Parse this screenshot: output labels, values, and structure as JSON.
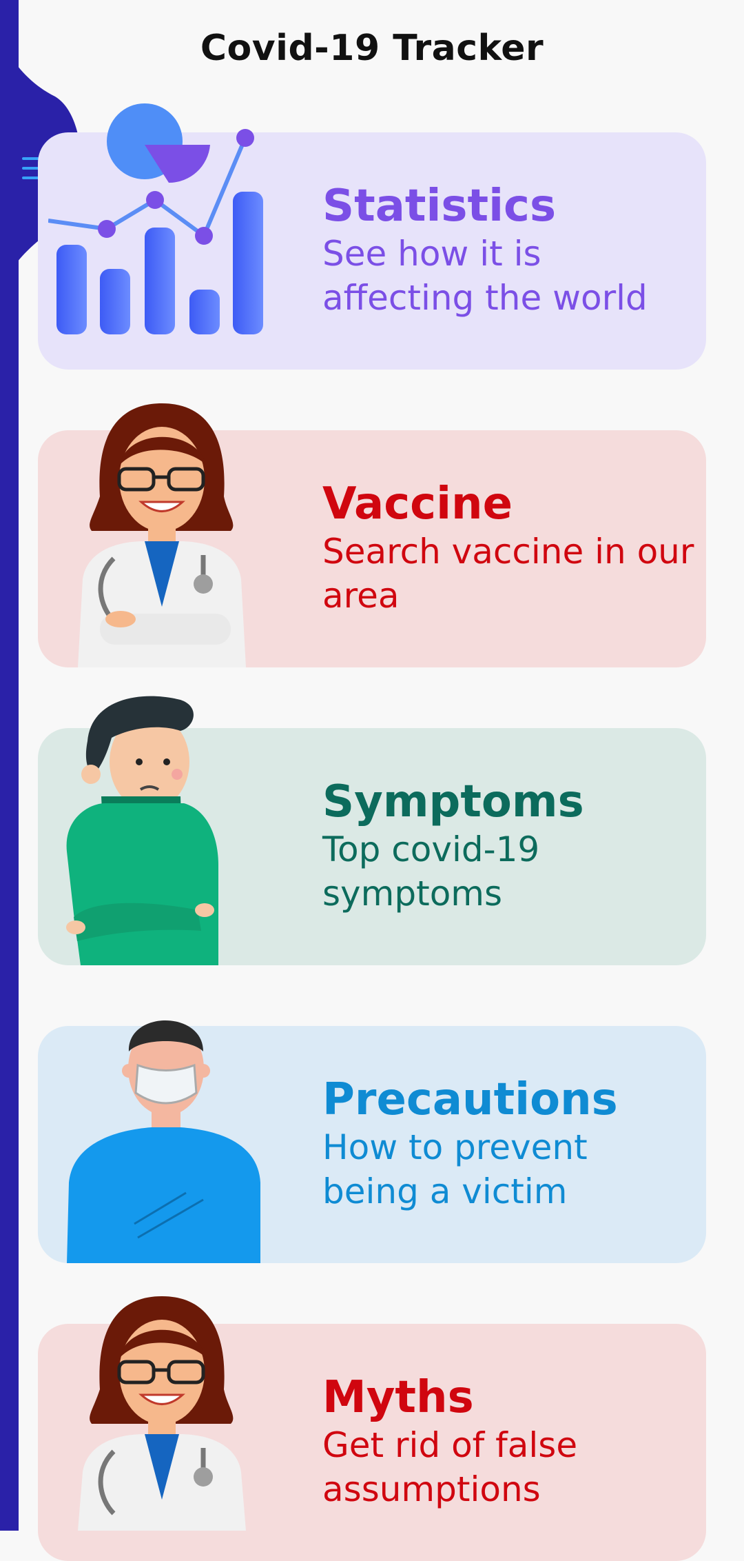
{
  "app": {
    "title": "Covid-19 Tracker"
  },
  "colors": {
    "drawer": "#2a21a8",
    "menu_icon": "#38a3f8",
    "background": "#f8f8f8"
  },
  "cards": [
    {
      "title": "Statistics",
      "desc": "See how it is affecting the world",
      "bg": "#e7e3fa",
      "color": "#7b4fe6",
      "icon": "bar-chart-illustration"
    },
    {
      "title": "Vaccine",
      "desc": "Search vaccine in our area",
      "bg": "#f5dcdc",
      "color": "#d0060f",
      "icon": "doctor-illustration"
    },
    {
      "title": "Symptoms",
      "desc": "Top covid-19 symptoms",
      "bg": "#dbe9e5",
      "color": "#0c6b5c",
      "icon": "sick-person-illustration"
    },
    {
      "title": "Precautions",
      "desc": "How to prevent being a victim",
      "bg": "#dbeaf6",
      "color": "#0f8bd3",
      "icon": "masked-person-illustration"
    },
    {
      "title": "Myths",
      "desc": "Get rid of false assumptions",
      "bg": "#f5dcdc",
      "color": "#d0060f",
      "icon": "doctor-illustration"
    }
  ]
}
